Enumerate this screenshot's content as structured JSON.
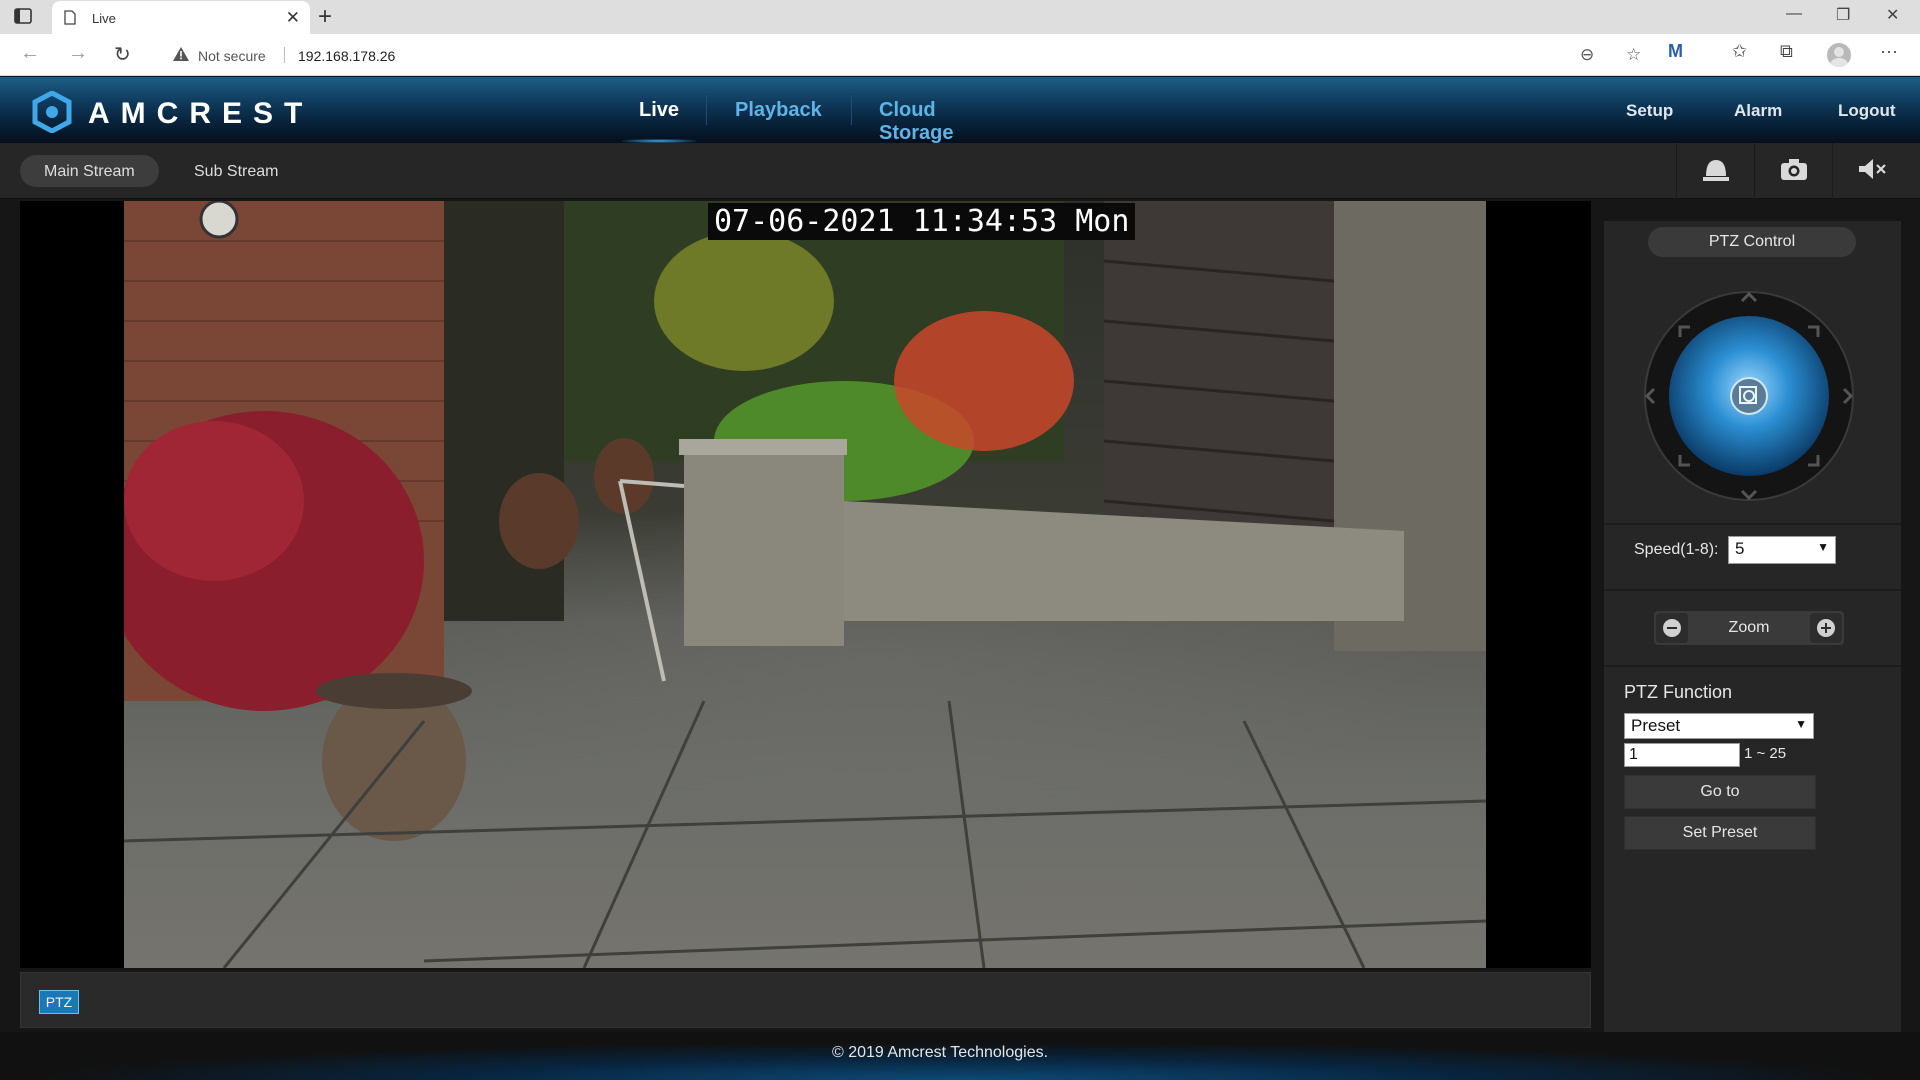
{
  "browser": {
    "tab_title": "Live",
    "address_warning": "Not secure",
    "url": "192.168.178.26"
  },
  "app": {
    "brand": "AMCREST",
    "nav": [
      "Live",
      "Playback",
      "Cloud Storage"
    ],
    "active_nav": "Live",
    "right_nav": [
      "Setup",
      "Alarm",
      "Logout"
    ]
  },
  "streams": {
    "main": "Main Stream",
    "sub": "Sub Stream",
    "active": "Main Stream"
  },
  "video": {
    "timestamp": "07-06-2021 11:34:53 Mon"
  },
  "ptzbar": {
    "button": "PTZ"
  },
  "ptz_panel": {
    "title": "PTZ Control",
    "speed_label": "Speed(1-8):",
    "speed_value": "5",
    "zoom_label": "Zoom",
    "function_title": "PTZ Function",
    "function_value": "Preset",
    "preset_value": "1",
    "preset_range": "1 ~ 25",
    "goto_label": "Go to",
    "set_preset_label": "Set Preset"
  },
  "footer": {
    "copyright": "© 2019 Amcrest Technologies."
  },
  "colors": {
    "accent": "#3fa8e8",
    "nav_inactive": "#5eb4e6",
    "header_top": "#1e5f86"
  }
}
